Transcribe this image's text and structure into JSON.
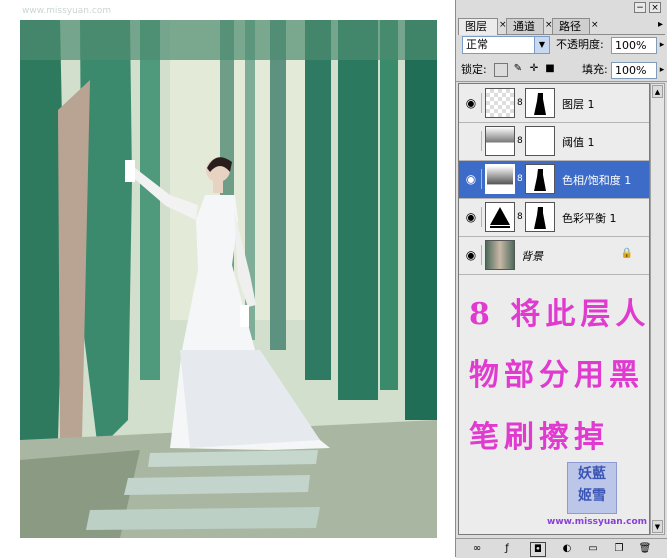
{
  "canvas": {
    "watermark": "www.missyuan.com"
  },
  "panel": {
    "tabs": [
      {
        "label": "图层",
        "active": true
      },
      {
        "label": "通道",
        "active": false
      },
      {
        "label": "路径",
        "active": false
      }
    ],
    "close_symbol": "×",
    "menu_arrow": "▸",
    "blend_mode": "正常",
    "opacity_label": "不透明度:",
    "opacity_value": "100%",
    "lock_label": "锁定:",
    "fill_label": "填充:",
    "fill_value": "100%",
    "layers": [
      {
        "name": "图层 1",
        "visible": true,
        "selected": false,
        "thumbnail": "transparent-pattern",
        "mask": "figure-mask"
      },
      {
        "name": "阈值 1",
        "visible": false,
        "selected": false,
        "thumbnail": "threshold-adjustment",
        "mask": "white-mask"
      },
      {
        "name": "色相/饱和度 1",
        "visible": true,
        "selected": true,
        "thumbnail": "hue-saturation-adjustment",
        "mask": "figure-mask"
      },
      {
        "name": "色彩平衡 1",
        "visible": true,
        "selected": false,
        "thumbnail": "color-balance-adjustment",
        "mask": "figure-mask"
      },
      {
        "name": "背景",
        "visible": true,
        "selected": false,
        "thumbnail": "photo",
        "locked": true
      }
    ],
    "annotation_lines": [
      "8 将此层人",
      "物部分用黑",
      "笔刷擦掉"
    ],
    "stamp_text": [
      "妖藍",
      "姬雪"
    ],
    "stamp_url": "www.missyuan.com",
    "bottom_icons": [
      "link-icon",
      "layer-style-icon",
      "mask-icon",
      "adjustment-icon",
      "folder-icon",
      "new-layer-icon",
      "trash-icon"
    ],
    "accent_color": "#3d6bc8",
    "annotation_color": "#e03ad0"
  }
}
